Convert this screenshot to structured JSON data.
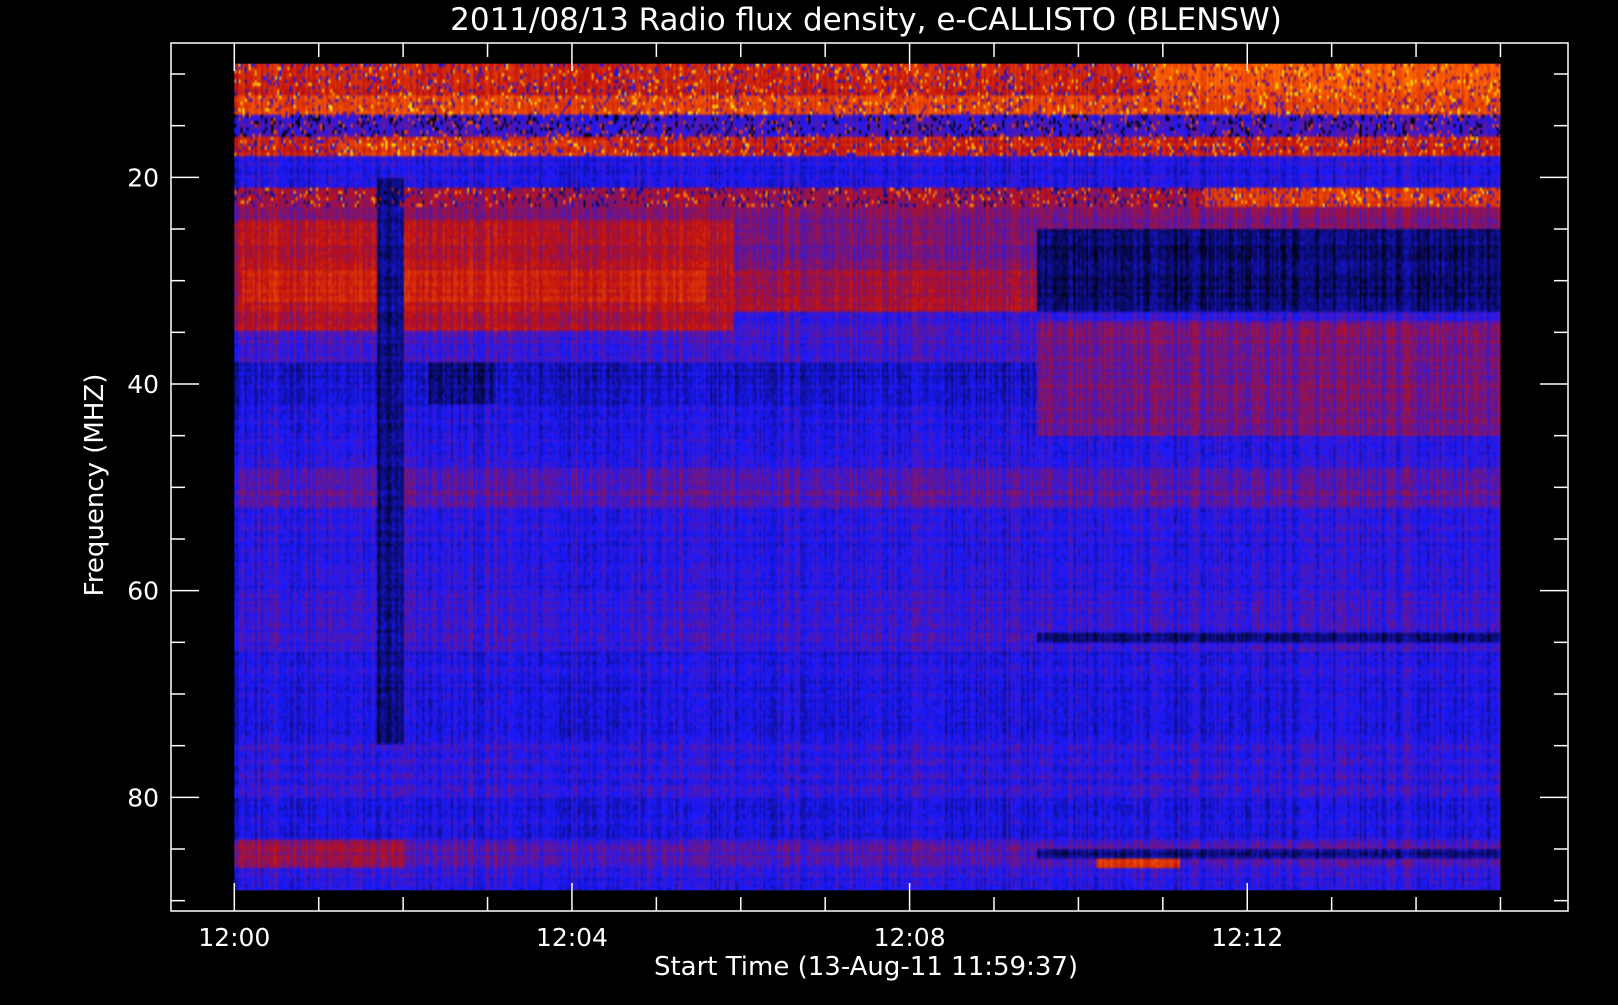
{
  "chart_data": {
    "type": "heatmap",
    "title": "2011/08/13  Radio flux density, e-CALLISTO (BLENSW)",
    "xlabel": "Start Time (13-Aug-11 11:59:37)",
    "ylabel": "Frequency (MHZ)",
    "x_ticks": [
      "12:00",
      "12:04",
      "12:08",
      "12:12"
    ],
    "x_tick_minutes": [
      0,
      4,
      8,
      12
    ],
    "y_ticks": [
      "20",
      "40",
      "60",
      "80"
    ],
    "y_tick_values": [
      20,
      40,
      60,
      80
    ],
    "xlim_minutes": [
      -0.75,
      15.8
    ],
    "data_x_range_minutes": [
      0,
      15
    ],
    "ylim": [
      7,
      91
    ],
    "data_y_range": [
      9,
      89
    ],
    "y_inverted": true,
    "colormap": [
      "#000000",
      "#1a1aff",
      "#c01010",
      "#ff6600",
      "#ffdd00"
    ],
    "bands": [
      {
        "f0": 9,
        "f1": 12,
        "level": 0.55,
        "streaks": true
      },
      {
        "f0": 12,
        "f1": 14,
        "level": 0.65,
        "streaks": true
      },
      {
        "f0": 14,
        "f1": 16,
        "level": 0.3,
        "streaks": true
      },
      {
        "f0": 16,
        "f1": 18,
        "level": 0.55,
        "streaks": true
      },
      {
        "f0": 18,
        "f1": 21,
        "level": 0.25,
        "streaks": false
      },
      {
        "f0": 21,
        "f1": 23,
        "level": 0.45,
        "streaks": true
      },
      {
        "f0": 23,
        "f1": 29,
        "level": 0.38,
        "streaks": false
      },
      {
        "f0": 29,
        "f1": 33,
        "level": 0.45,
        "streaks": false
      },
      {
        "f0": 33,
        "f1": 38,
        "level": 0.3,
        "streaks": false
      },
      {
        "f0": 38,
        "f1": 42,
        "level": 0.2,
        "streaks": false
      },
      {
        "f0": 42,
        "f1": 48,
        "level": 0.25,
        "streaks": false
      },
      {
        "f0": 48,
        "f1": 52,
        "level": 0.34,
        "streaks": false
      },
      {
        "f0": 52,
        "f1": 60,
        "level": 0.26,
        "streaks": false
      },
      {
        "f0": 60,
        "f1": 66,
        "level": 0.28,
        "streaks": false
      },
      {
        "f0": 66,
        "f1": 74,
        "level": 0.24,
        "streaks": false
      },
      {
        "f0": 74,
        "f1": 80,
        "level": 0.27,
        "streaks": false
      },
      {
        "f0": 80,
        "f1": 84,
        "level": 0.24,
        "streaks": false
      },
      {
        "f0": 84,
        "f1": 87,
        "level": 0.32,
        "streaks": false
      },
      {
        "f0": 87,
        "f1": 89,
        "level": 0.26,
        "streaks": false
      }
    ],
    "features": [
      {
        "t0": 0,
        "t1": 5.9,
        "f0": 24,
        "f1": 35,
        "level": 0.48
      },
      {
        "t0": 0.1,
        "t1": 5.6,
        "f0": 29,
        "f1": 32,
        "level": 0.55
      },
      {
        "t0": 1.2,
        "t1": 4.6,
        "f0": 16.5,
        "f1": 18,
        "level": 0.62
      },
      {
        "t0": 9.5,
        "t1": 15,
        "f0": 25,
        "f1": 33,
        "level": 0.1
      },
      {
        "t0": 9.5,
        "t1": 15,
        "f0": 34,
        "f1": 45,
        "level": 0.38
      },
      {
        "t0": 9.5,
        "t1": 15,
        "f0": 64,
        "f1": 65,
        "level": 0.08
      },
      {
        "t0": 9.5,
        "t1": 15,
        "f0": 85,
        "f1": 86,
        "level": 0.12
      },
      {
        "t0": 10.2,
        "t1": 11.2,
        "f0": 86,
        "f1": 87,
        "level": 0.6
      },
      {
        "t0": 11.5,
        "t1": 15,
        "f0": 21,
        "f1": 23,
        "level": 0.62
      },
      {
        "t0": 10.9,
        "t1": 15,
        "f0": 9,
        "f1": 12,
        "level": 0.7
      },
      {
        "t0": 0,
        "t1": 2,
        "f0": 84,
        "f1": 87,
        "level": 0.42
      },
      {
        "t0": 1.7,
        "t1": 2.0,
        "f0": 20,
        "f1": 75,
        "level": 0.12
      },
      {
        "t0": 2.3,
        "t1": 3.1,
        "f0": 38,
        "f1": 42,
        "level": 0.12
      }
    ]
  }
}
